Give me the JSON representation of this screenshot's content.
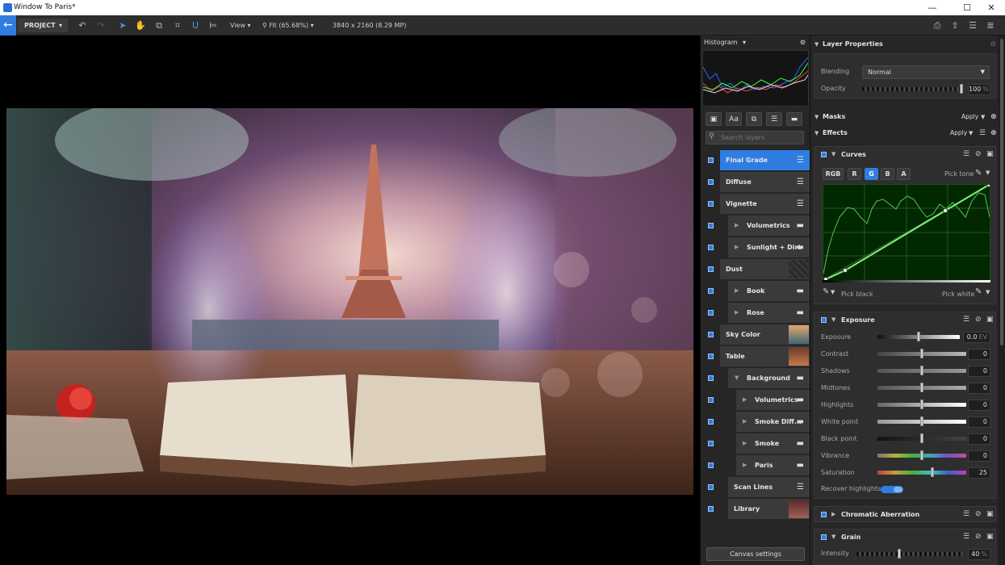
{
  "window": {
    "title": "Window To Paris*"
  },
  "window_controls": {
    "minimize": "—",
    "maximize": "☐",
    "close": "✕"
  },
  "toolbar": {
    "project_label": "PROJECT",
    "view_label": "View",
    "zoom_label": "Fit (65.68%)",
    "image_info": "3840 x 2160 (8.29 MP)"
  },
  "histogram": {
    "label": "Histogram"
  },
  "layers_panel": {
    "search_placeholder": "Search layers",
    "layers": [
      {
        "name": "Final Grade",
        "kind": "adjustment",
        "selected": true
      },
      {
        "name": "Diffuse",
        "kind": "adjustment"
      },
      {
        "name": "Vignette",
        "kind": "adjustment"
      },
      {
        "name": "Volumetrics",
        "kind": "group"
      },
      {
        "name": "Sunlight + Dirt",
        "kind": "group"
      },
      {
        "name": "Dust",
        "kind": "image"
      },
      {
        "name": "Book",
        "kind": "group"
      },
      {
        "name": "Rose",
        "kind": "group"
      },
      {
        "name": "Sky Color",
        "kind": "image"
      },
      {
        "name": "Table",
        "kind": "image"
      },
      {
        "name": "Background",
        "kind": "group",
        "expanded": true
      },
      {
        "name": "Volumetrics",
        "kind": "group"
      },
      {
        "name": "Smoke Diff...",
        "kind": "group"
      },
      {
        "name": "Smoke",
        "kind": "group"
      },
      {
        "name": "Paris",
        "kind": "group"
      },
      {
        "name": "Scan Lines",
        "kind": "adjustment"
      },
      {
        "name": "Library",
        "kind": "image"
      }
    ],
    "canvas_settings_label": "Canvas settings"
  },
  "layer_properties": {
    "title": "Layer Properties",
    "blending_label": "Blending",
    "blending_value": "Normal",
    "opacity_label": "Opacity",
    "opacity_value": "100",
    "opacity_unit": "%",
    "opacity_fraction": 1.0
  },
  "masks": {
    "title": "Masks",
    "apply_label": "Apply"
  },
  "effects": {
    "title": "Effects",
    "apply_label": "Apply",
    "curves": {
      "title": "Curves",
      "channels": [
        "RGB",
        "R",
        "G",
        "B",
        "A"
      ],
      "active_channel": "G",
      "pick_tone_label": "Pick tone",
      "pick_black_label": "Pick black",
      "pick_white_label": "Pick white"
    },
    "exposure": {
      "title": "Exposure",
      "rows": [
        {
          "label": "Exposure",
          "value": "0.0",
          "unit": "EV"
        },
        {
          "label": "Contrast",
          "value": "0"
        },
        {
          "label": "Shadows",
          "value": "0"
        },
        {
          "label": "Midtones",
          "value": "0"
        },
        {
          "label": "Highlights",
          "value": "0"
        },
        {
          "label": "White point",
          "value": "0"
        },
        {
          "label": "Black point",
          "value": "0"
        },
        {
          "label": "Vibrance",
          "value": "0"
        },
        {
          "label": "Saturation",
          "value": "25"
        }
      ],
      "recover_highlights_label": "Recover highlights",
      "recover_highlights_on": true
    },
    "chromatic_aberration": {
      "title": "Chromatic Aberration"
    },
    "grain": {
      "title": "Grain",
      "intensity_label": "Intensity",
      "intensity_value": "40",
      "intensity_unit": "%"
    }
  },
  "colors": {
    "accent": "#2f7de1",
    "panel": "#262626",
    "canvas": "#000000"
  }
}
